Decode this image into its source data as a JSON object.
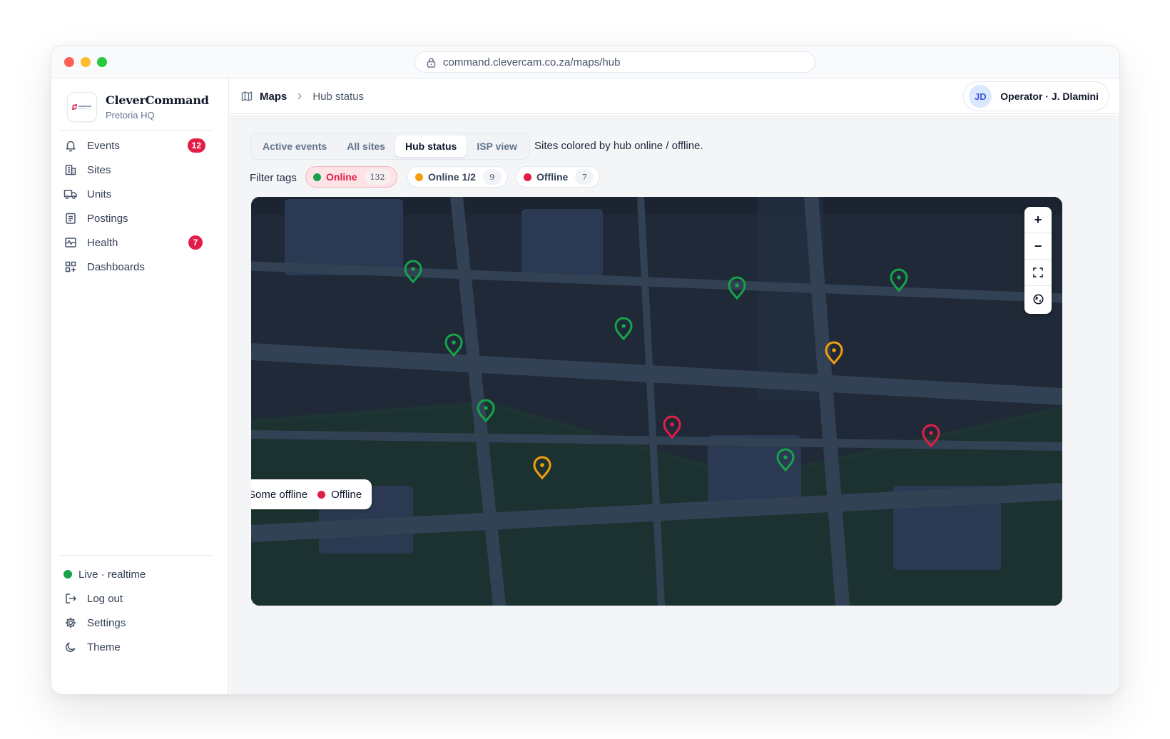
{
  "browser": {
    "url": "command.clevercam.co.za/maps/hub"
  },
  "brand": {
    "name": "CleverCommand",
    "subtitle": "Pretoria HQ"
  },
  "nav": {
    "items": [
      {
        "label": "Events",
        "icon": "bell-icon",
        "badge": "12"
      },
      {
        "label": "Sites",
        "icon": "building-icon"
      },
      {
        "label": "Units",
        "icon": "truck-icon"
      },
      {
        "label": "Postings",
        "icon": "clipboard-icon"
      },
      {
        "label": "Health",
        "icon": "pulse-icon",
        "badge": "7"
      },
      {
        "label": "Dashboards",
        "icon": "dashboard-icon"
      }
    ],
    "footer": [
      {
        "label": "Live · realtime",
        "icon": "status-dot"
      },
      {
        "label": "Log out",
        "icon": "logout-icon"
      },
      {
        "label": "Settings",
        "icon": "gear-icon"
      },
      {
        "label": "Theme",
        "icon": "moon-icon"
      }
    ]
  },
  "header": {
    "crumb_root": "Maps",
    "crumb_current": "Hub status",
    "user_initials": "JD",
    "user_label": "Operator · J. Dlamini"
  },
  "map_view": {
    "tabs": [
      "Active events",
      "All sites",
      "Hub status",
      "ISP view"
    ],
    "active_tab": "Hub status",
    "hint": "Sites colored by hub online / offline.",
    "filter_label": "Filter tags",
    "filters": [
      {
        "label": "Online",
        "count": "132",
        "color": "#16a34a",
        "selected": true
      },
      {
        "label": "Online 1/2",
        "count": "9",
        "color": "#f59e0b",
        "selected": false
      },
      {
        "label": "Offline",
        "count": "7",
        "color": "#e11d48",
        "selected": false
      }
    ],
    "zoom_controls": [
      "+",
      "−"
    ],
    "legend": {
      "partial_label": "Some offline",
      "offline_label": "Offline"
    },
    "colors": {
      "online": "#16a34a",
      "partial": "#f59e0b",
      "offline": "#e11d48"
    }
  }
}
